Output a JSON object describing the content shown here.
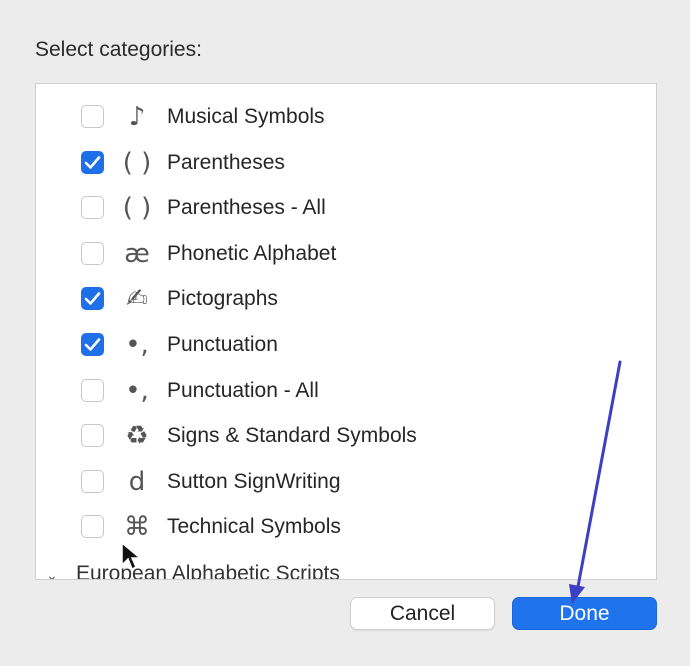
{
  "dialog": {
    "prompt": "Select categories:"
  },
  "categories": [
    {
      "label": "Musical Symbols",
      "glyph": "♪",
      "checked": false
    },
    {
      "label": "Parentheses",
      "glyph": "( )",
      "checked": true
    },
    {
      "label": "Parentheses - All",
      "glyph": "( )",
      "checked": false
    },
    {
      "label": "Phonetic Alphabet",
      "glyph": "æ",
      "checked": false
    },
    {
      "label": "Pictographs",
      "glyph": "✍",
      "checked": true
    },
    {
      "label": "Punctuation",
      "glyph": "•,",
      "checked": true
    },
    {
      "label": "Punctuation - All",
      "glyph": "•,",
      "checked": false
    },
    {
      "label": "Signs & Standard Symbols",
      "glyph": "♻",
      "checked": false
    },
    {
      "label": "Sutton SignWriting",
      "glyph": "d",
      "checked": false
    },
    {
      "label": "Technical Symbols",
      "glyph": "⌘",
      "checked": false
    }
  ],
  "group": {
    "label": "European Alphabetic Scripts",
    "icon": "chevron-down-icon"
  },
  "buttons": {
    "cancel": "Cancel",
    "done": "Done"
  },
  "colors": {
    "accent": "#1f74ee",
    "checkbox_checked": "#1f6fe8",
    "annotation_arrow": "#3d3fc4"
  }
}
